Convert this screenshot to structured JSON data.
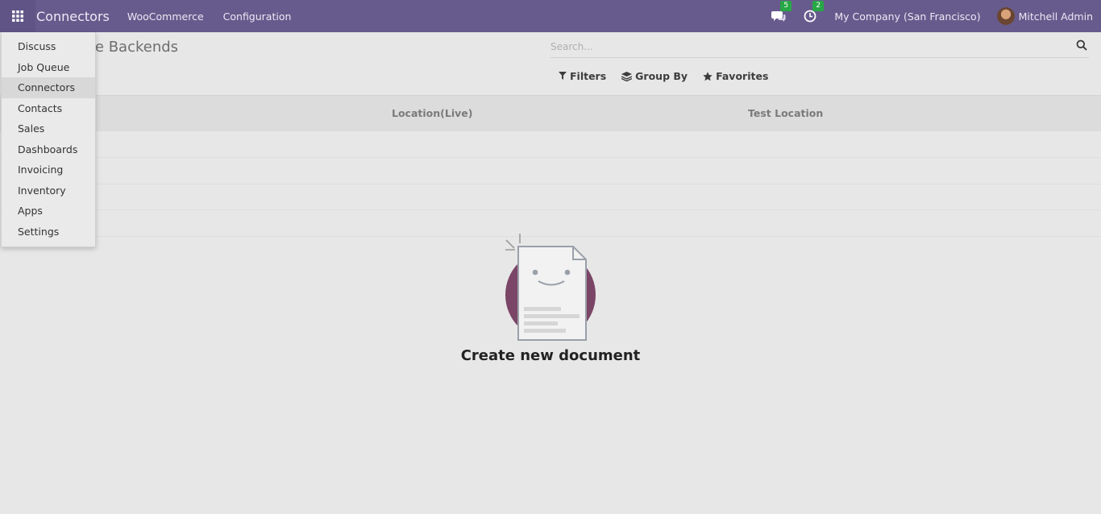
{
  "navbar": {
    "app_title": "Connectors",
    "menus": [
      "WooCommerce",
      "Configuration"
    ],
    "messages_count": "5",
    "activities_count": "2",
    "company": "My Company (San Francisco)",
    "user": "Mitchell Admin",
    "bg_color": "#675b8d"
  },
  "control_panel": {
    "breadcrumb": "WooCommerce Backends",
    "breadcrumb_visible": "rce Backends",
    "search_placeholder": "Search...",
    "filters_label": "Filters",
    "groupby_label": "Group By",
    "favorites_label": "Favorites"
  },
  "list": {
    "columns": [
      "Location(Live)",
      "Test Location"
    ]
  },
  "help": {
    "title": "Create new document"
  },
  "apps_menu": {
    "items": [
      "Discuss",
      "Job Queue",
      "Connectors",
      "Contacts",
      "Sales",
      "Dashboards",
      "Invoicing",
      "Inventory",
      "Apps",
      "Settings"
    ],
    "active": "Connectors"
  },
  "icons": {
    "apps": "grid-icon",
    "messages": "chat-icon",
    "activities": "clock-icon",
    "search": "search-icon",
    "filters": "filter-icon",
    "groupby": "layers-icon",
    "favorites": "star-icon"
  }
}
